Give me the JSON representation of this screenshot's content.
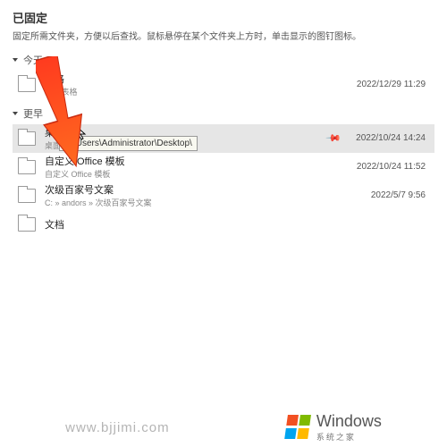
{
  "header": {
    "title": "已固定",
    "subtitle": "固定所需文件夹，方便以后查找。鼠标悬停在某个文件夹上方时，单击显示的图钉图标。"
  },
  "groups": {
    "today": {
      "label": "今天"
    },
    "earlier": {
      "label": "更早"
    }
  },
  "items": {
    "today": [
      {
        "name": "表格",
        "path": "E: » 表格",
        "date": "2022/12/29 11:29"
      }
    ],
    "earlier": [
      {
        "name": "桌面",
        "path": "桌面",
        "date": "2022/10/24 14:24",
        "pinned": true,
        "selected": true
      },
      {
        "name": "自定义 Office 模板",
        "path": "自定义 Office 模板",
        "date": "2022/10/24 11:52"
      },
      {
        "name": "次级百家号文案",
        "path": "C: » andors » 次级百家号文案",
        "date": "2022/5/7 9:56"
      },
      {
        "name": "文档",
        "path": "",
        "date": ""
      }
    ]
  },
  "tooltip": "C:\\Users\\Administrator\\Desktop\\",
  "watermark": {
    "url": "www.bjjimi.com",
    "brand": "Windows",
    "brand_sub": "系统之家"
  }
}
